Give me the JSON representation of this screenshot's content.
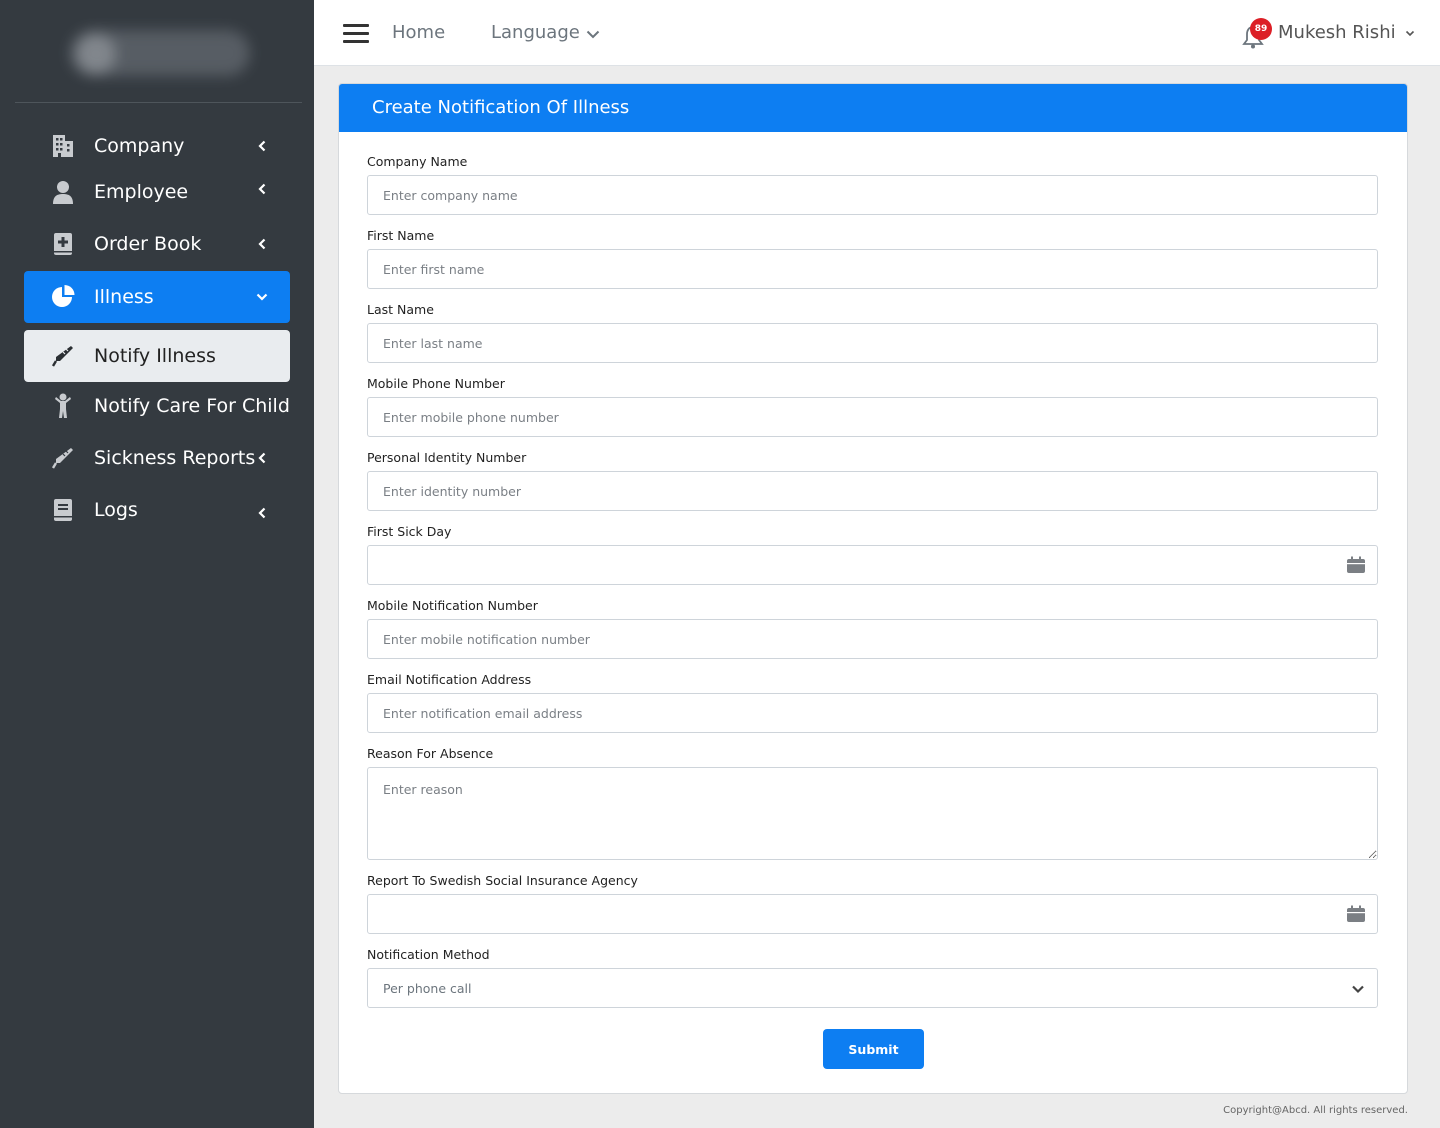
{
  "sidebar": {
    "items": [
      {
        "label": "Company",
        "icon": "building-icon"
      },
      {
        "label": "Employee",
        "icon": "user-icon"
      },
      {
        "label": "Order Book",
        "icon": "book-medical-icon"
      },
      {
        "label": "Illness",
        "icon": "pie-chart-icon"
      },
      {
        "label": "Notify Illness",
        "icon": "thermometer-icon"
      },
      {
        "label": "Notify Care For Child",
        "icon": "child-icon"
      },
      {
        "label": "Sickness Reports",
        "icon": "thermometer-icon"
      },
      {
        "label": "Logs",
        "icon": "book-icon"
      }
    ]
  },
  "topbar": {
    "home": "Home",
    "language": "Language",
    "notification_count": "89",
    "user_name": "Mukesh Rishi"
  },
  "form": {
    "title": "Create Notification Of Illness",
    "fields": {
      "company_name": {
        "label": "Company Name",
        "placeholder": "Enter company name"
      },
      "first_name": {
        "label": "First Name",
        "placeholder": "Enter first name"
      },
      "last_name": {
        "label": "Last Name",
        "placeholder": "Enter last name"
      },
      "mobile_phone": {
        "label": "Mobile Phone Number",
        "placeholder": "Enter mobile phone number"
      },
      "identity_number": {
        "label": "Personal Identity Number",
        "placeholder": "Enter identity number"
      },
      "first_sick_day": {
        "label": "First Sick Day",
        "placeholder": ""
      },
      "mobile_notification": {
        "label": "Mobile Notification Number",
        "placeholder": "Enter mobile notification number"
      },
      "email_notification": {
        "label": "Email Notification Address",
        "placeholder": "Enter notification email address"
      },
      "reason": {
        "label": "Reason For Absence",
        "placeholder": "Enter reason"
      },
      "report_agency": {
        "label": "Report To Swedish Social Insurance Agency",
        "placeholder": ""
      },
      "notification_method": {
        "label": "Notification Method",
        "value": "Per phone call"
      }
    },
    "submit_label": "Submit"
  },
  "footer": {
    "copyright": "Copyright@Abcd. All rights reserved."
  },
  "colors": {
    "primary": "#0d7ef2",
    "sidebar": "#343a40",
    "badge": "#dc1f26"
  }
}
